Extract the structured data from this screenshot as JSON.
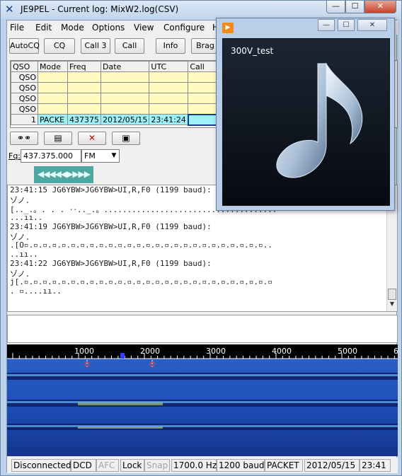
{
  "window": {
    "title": "JE9PEL - Current log: MixW2.log(CSV)",
    "min": "—",
    "max": "☐",
    "close": "✕"
  },
  "menu": [
    "File",
    "Edit",
    "Mode",
    "Options",
    "View",
    "Configure",
    "H"
  ],
  "toolbar": [
    "AutoCQ",
    "CQ",
    "Call 3",
    "Call",
    "Info",
    "Brag"
  ],
  "grid": {
    "headers": [
      "QSO",
      "Mode",
      "Freq",
      "Date",
      "UTC",
      "Call"
    ],
    "rows": [
      {
        "label": "QSO",
        "cells": [
          "",
          "",
          "",
          "",
          ""
        ]
      },
      {
        "label": "QSO",
        "cells": [
          "",
          "",
          "",
          "",
          ""
        ]
      },
      {
        "label": "QSO",
        "cells": [
          "",
          "",
          "",
          "",
          ""
        ]
      },
      {
        "label": "QSO",
        "cells": [
          "",
          "",
          "",
          "",
          ""
        ]
      },
      {
        "label": "1",
        "cells": [
          "PACKE",
          "437375",
          "2012/05/15",
          "23:41:24",
          ""
        ]
      }
    ]
  },
  "freq": {
    "label": "Fq:",
    "value": "437.375.000",
    "mode": "FM"
  },
  "arrows": "◀◀◀◀◀▶▶▶▶",
  "log_lines": [
    "23:41:15 JG6YBW>JG6YBW>UI,R,F0 (1199 baud):",
    "ゾノ.",
    "[.._.。. . . ‥.._.。.....................................",
    "...ıı..",
    "23:41:19 JG6YBW>JG6YBW>UI,R,F0 (1199 baud):",
    "ゾノ.",
    ".[O▫.▫.▫.▫.▫.▫.▫.▫.▫.▫.▫.▫.▫.▫.▫.▫.▫.▫.▫.▫.▫.▫.▫.▫.▫.▫..",
    "..ıı..",
    "23:41:22 JG6YBW>JG6YBW>UI,R,F0 (1199 baud):",
    "ゾノ.",
    "j[.▫.▫.▫.▫.▫.▫.▫.▫.▫.▫.▫.▫.▫.▫.▫.▫.▫.▫.▫.▫.▫.▫.▫.▫.▫.▫.▫",
    ". ▫....ıı.."
  ],
  "ruler": [
    "1000",
    "2000",
    "3000",
    "4000",
    "5000",
    "6"
  ],
  "status": [
    {
      "text": "Disconnected",
      "dim": false
    },
    {
      "text": "DCD",
      "dim": false
    },
    {
      "text": "AFC",
      "dim": true
    },
    {
      "text": "Lock",
      "dim": false
    },
    {
      "text": "Snap",
      "dim": true
    },
    {
      "text": "1700.0 Hz",
      "dim": false
    },
    {
      "text": "1200 baud",
      "dim": false
    },
    {
      "text": "PACKET",
      "dim": false
    },
    {
      "text": "2012/05/15",
      "dim": false
    },
    {
      "text": "23:41",
      "dim": false
    }
  ],
  "popup": {
    "title": "300V_test",
    "min": "—",
    "max": "☐",
    "close": "✕"
  }
}
